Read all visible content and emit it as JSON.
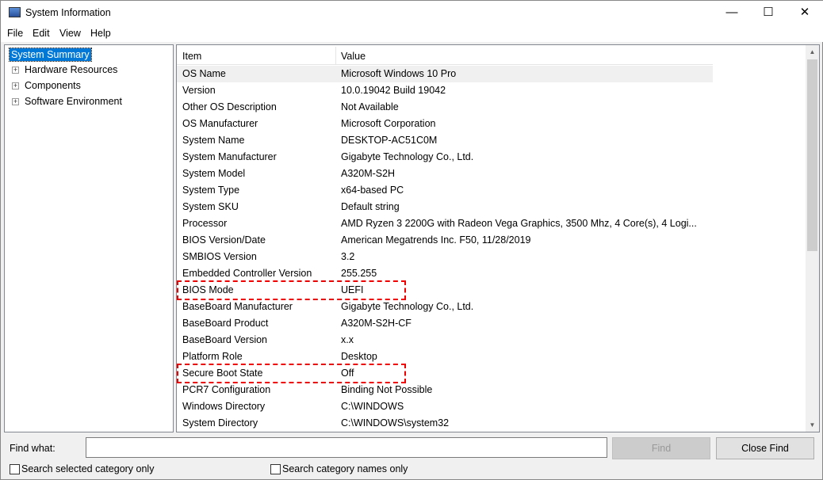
{
  "window": {
    "title": "System Information",
    "minimize": "—",
    "maximize": "☐",
    "close": "✕"
  },
  "menu": [
    {
      "label": "File"
    },
    {
      "label": "Edit"
    },
    {
      "label": "View"
    },
    {
      "label": "Help"
    }
  ],
  "tree": {
    "selected": "System Summary",
    "items": [
      "Hardware Resources",
      "Components",
      "Software Environment"
    ]
  },
  "table": {
    "headers": [
      "Item",
      "Value"
    ],
    "rows": [
      [
        "OS Name",
        "Microsoft Windows 10 Pro"
      ],
      [
        "Version",
        "10.0.19042 Build 19042"
      ],
      [
        "Other OS Description",
        "Not Available"
      ],
      [
        "OS Manufacturer",
        "Microsoft Corporation"
      ],
      [
        "System Name",
        "DESKTOP-AC51C0M"
      ],
      [
        "System Manufacturer",
        "Gigabyte Technology Co., Ltd."
      ],
      [
        "System Model",
        "A320M-S2H"
      ],
      [
        "System Type",
        "x64-based PC"
      ],
      [
        "System SKU",
        "Default string"
      ],
      [
        "Processor",
        "AMD Ryzen 3 2200G with Radeon Vega Graphics, 3500 Mhz, 4 Core(s), 4 Logi..."
      ],
      [
        "BIOS Version/Date",
        "American Megatrends Inc. F50, 11/28/2019"
      ],
      [
        "SMBIOS Version",
        "3.2"
      ],
      [
        "Embedded Controller Version",
        "255.255"
      ],
      [
        "BIOS Mode",
        "UEFI"
      ],
      [
        "BaseBoard Manufacturer",
        "Gigabyte Technology Co., Ltd."
      ],
      [
        "BaseBoard Product",
        "A320M-S2H-CF"
      ],
      [
        "BaseBoard Version",
        "x.x"
      ],
      [
        "Platform Role",
        "Desktop"
      ],
      [
        "Secure Boot State",
        "Off"
      ],
      [
        "PCR7 Configuration",
        "Binding Not Possible"
      ],
      [
        "Windows Directory",
        "C:\\WINDOWS"
      ],
      [
        "System Directory",
        "C:\\WINDOWS\\system32"
      ]
    ]
  },
  "find": {
    "label": "Find what:",
    "value": "",
    "find_button": "Find",
    "close_button": "Close Find",
    "chk1": "Search selected category only",
    "chk2": "Search category names only"
  },
  "colors": {
    "highlight": "#e00000",
    "selection": "#0078d7"
  }
}
